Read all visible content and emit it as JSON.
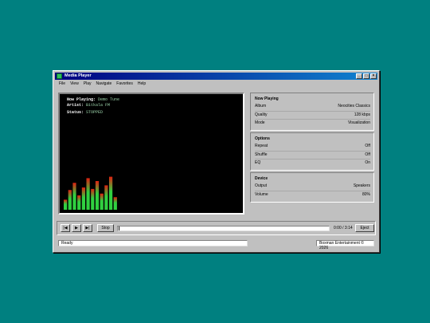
{
  "window": {
    "title": "Media Player",
    "buttons": [
      "_",
      "□",
      "×"
    ]
  },
  "menu": [
    "File",
    "View",
    "Play",
    "Navigate",
    "Favorites",
    "Help"
  ],
  "display": {
    "now_playing_label": "Now Playing:",
    "now_playing": "Demo Tune",
    "artist_label": "Artist:",
    "artist": "Bitkala FM",
    "status_label": "Status:",
    "status": "STOPPED",
    "visualizer_levels": [
      0.28,
      0.55,
      0.75,
      0.4,
      0.62,
      0.88,
      0.58,
      0.8,
      0.45,
      0.68,
      0.92,
      0.35
    ],
    "colors": {
      "low": "#30d040",
      "high": "#e02010"
    }
  },
  "panels": [
    {
      "title": "Now Playing",
      "rows": [
        {
          "label": "Album",
          "value": "Neocities Classics"
        },
        {
          "label": "Quality",
          "value": "128 kbps"
        },
        {
          "label": "Mode",
          "value": "Visualization"
        }
      ]
    },
    {
      "title": "Options",
      "rows": [
        {
          "label": "Repeat",
          "value": "Off"
        },
        {
          "label": "Shuffle",
          "value": "Off"
        },
        {
          "label": "EQ",
          "value": "On"
        }
      ]
    },
    {
      "title": "Device",
      "rows": [
        {
          "label": "Output",
          "value": "Speakers"
        },
        {
          "label": "Volume",
          "value": "80%"
        }
      ]
    }
  ],
  "controls": {
    "prev": "|◀",
    "play": "▶",
    "next": "▶|",
    "stop": "Stop",
    "time": "0:00 / 3:14",
    "eject": "Eject",
    "progress": 0.0
  },
  "statusbar": {
    "left": "Ready",
    "right": "Boxman Entertainment © 2026"
  }
}
